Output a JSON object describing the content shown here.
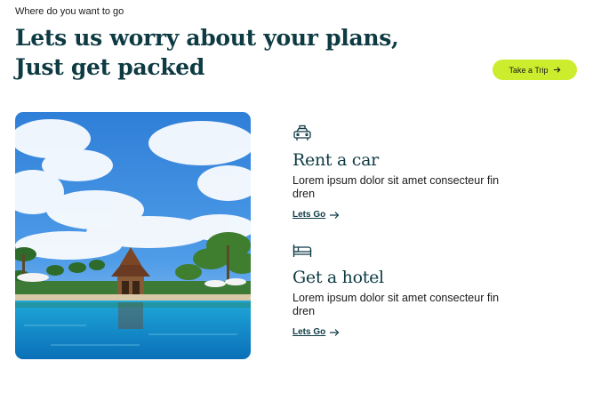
{
  "header": {
    "eyebrow": "Where do you want to go",
    "headline_line1": "Lets us worry about your plans,",
    "headline_line2": "Just get packed",
    "cta_label": "Take a Trip"
  },
  "services": [
    {
      "icon": "car-icon",
      "title": "Rent a car",
      "description": "Lorem ipsum dolor sit amet consecteur fin dren",
      "link_label": "Lets Go"
    },
    {
      "icon": "bed-icon",
      "title": "Get a hotel",
      "description": "Lorem ipsum dolor sit amet consecteur fin dren",
      "link_label": "Lets Go"
    }
  ],
  "colors": {
    "accent": "#ccec2e",
    "heading": "#0e3b43",
    "text": "#1a1a1a"
  }
}
